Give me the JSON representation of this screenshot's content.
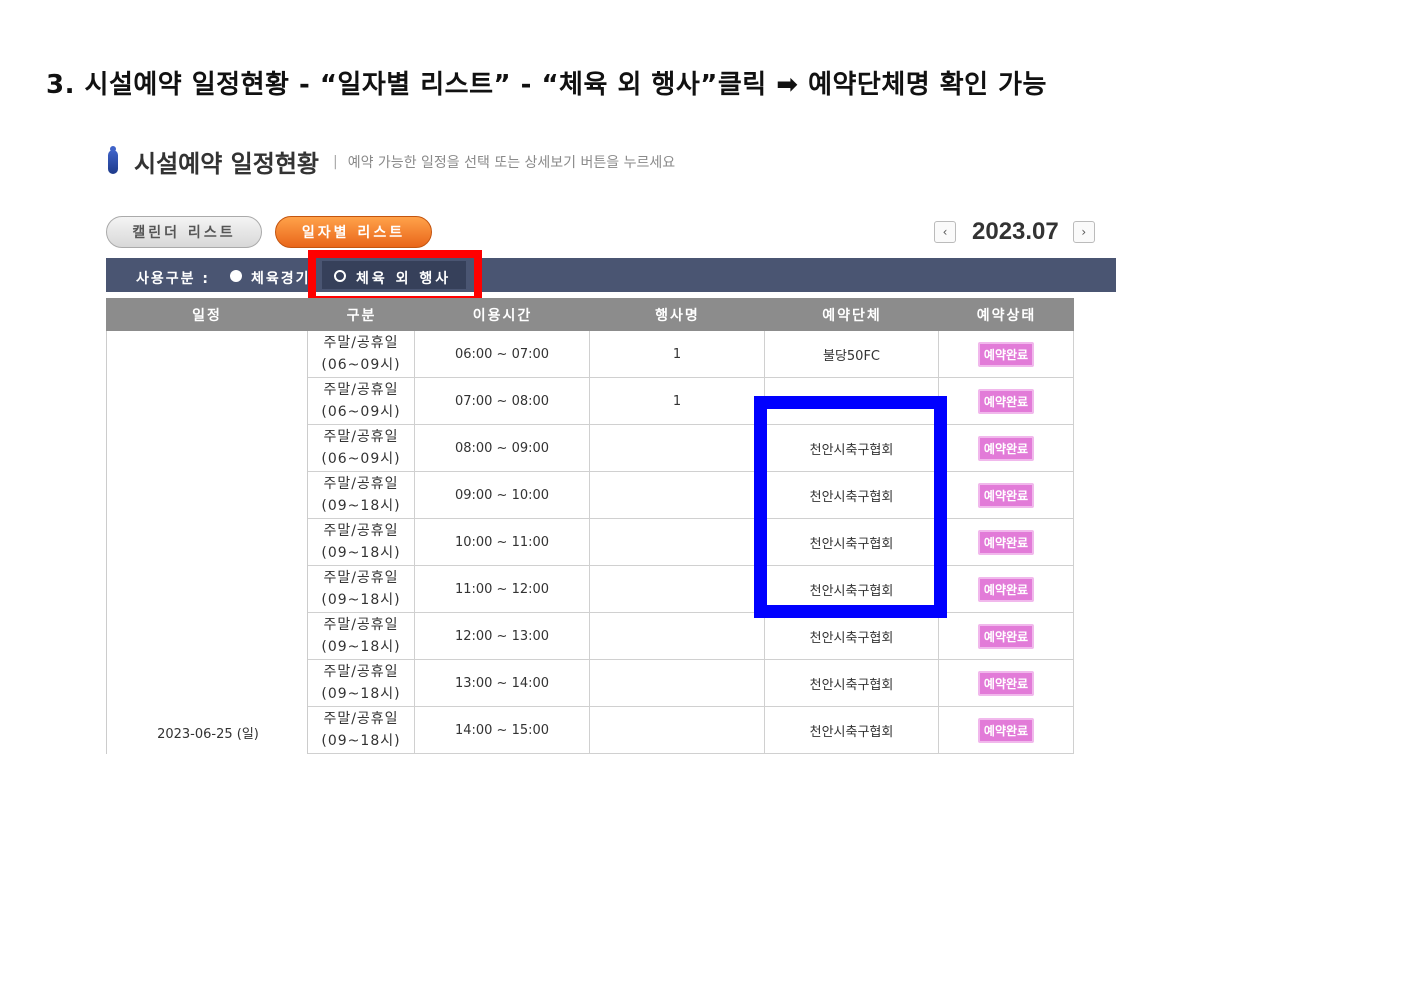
{
  "heading": "3. 시설예약 일정현황 - “일자별 리스트” - “체육 외 행사”클릭 ➡ 예약단체명 확인 가능",
  "section": {
    "title": "시설예약 일정현황",
    "separator": "|",
    "subtitle": "예약 가능한 일정을 선택 또는 상세보기 버튼을 누르세요"
  },
  "tabs": {
    "calendar": "캘린더 리스트",
    "daily": "일자별 리스트"
  },
  "month_nav": {
    "prev": "‹",
    "label": "2023.07",
    "next": "›"
  },
  "filter": {
    "label": "사용구분 :",
    "option_1": "체육경기",
    "option_2": "체육 외 행사",
    "selected": "체육 외 행사"
  },
  "table": {
    "headers": [
      "일정",
      "구분",
      "이용시간",
      "행사명",
      "예약단체",
      "예약상태"
    ],
    "date": "2023-06-25 (일)",
    "rows": [
      {
        "type": "주말/공휴일",
        "range": "(06~09시)",
        "time": "06:00 ~ 07:00",
        "event": "1",
        "org": "불당50FC",
        "status": "예약완료"
      },
      {
        "type": "주말/공휴일",
        "range": "(06~09시)",
        "time": "07:00 ~ 08:00",
        "event": "1",
        "org": "",
        "status": "예약완료"
      },
      {
        "type": "주말/공휴일",
        "range": "(06~09시)",
        "time": "08:00 ~ 09:00",
        "event": "",
        "org": "천안시축구협회",
        "status": "예약완료"
      },
      {
        "type": "주말/공휴일",
        "range": "(09~18시)",
        "time": "09:00 ~ 10:00",
        "event": "",
        "org": "천안시축구협회",
        "status": "예약완료"
      },
      {
        "type": "주말/공휴일",
        "range": "(09~18시)",
        "time": "10:00 ~ 11:00",
        "event": "",
        "org": "천안시축구협회",
        "status": "예약완료"
      },
      {
        "type": "주말/공휴일",
        "range": "(09~18시)",
        "time": "11:00 ~ 12:00",
        "event": "",
        "org": "천안시축구협회",
        "status": "예약완료"
      },
      {
        "type": "주말/공휴일",
        "range": "(09~18시)",
        "time": "12:00 ~ 13:00",
        "event": "",
        "org": "천안시축구협회",
        "status": "예약완료"
      },
      {
        "type": "주말/공휴일",
        "range": "(09~18시)",
        "time": "13:00 ~ 14:00",
        "event": "",
        "org": "천안시축구협회",
        "status": "예약완료"
      },
      {
        "type": "주말/공휴일",
        "range": "(09~18시)",
        "time": "14:00 ~ 15:00",
        "event": "",
        "org": "천안시축구협회",
        "status": "예약완료"
      }
    ]
  },
  "colors": {
    "highlight_red": "#ff0000",
    "highlight_blue": "#0000ff",
    "filter_bar": "#4a5572",
    "active_tab": "#f57a2a",
    "status_badge": "#e27bd8"
  }
}
